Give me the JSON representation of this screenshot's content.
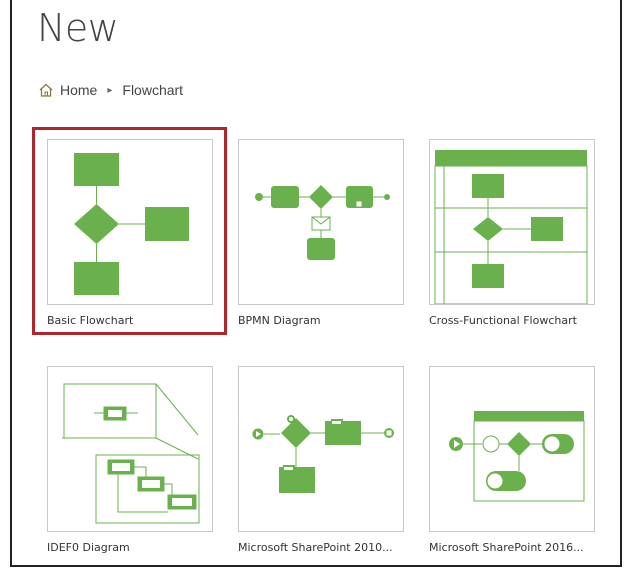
{
  "page": {
    "title": "New"
  },
  "breadcrumb": {
    "home": "Home",
    "current": "Flowchart"
  },
  "templates": [
    {
      "label": "Basic Flowchart",
      "icon": "basic-flowchart-thumbnail",
      "selected": true
    },
    {
      "label": "BPMN Diagram",
      "icon": "bpmn-diagram-thumbnail",
      "selected": false
    },
    {
      "label": "Cross-Functional Flowchart",
      "icon": "cross-functional-flowchart-thumbnail",
      "selected": false
    },
    {
      "label": "IDEF0 Diagram",
      "icon": "idef0-diagram-thumbnail",
      "selected": false
    },
    {
      "label": "Microsoft SharePoint 2010...",
      "icon": "sharepoint-2010-thumbnail",
      "selected": false
    },
    {
      "label": "Microsoft SharePoint 2016...",
      "icon": "sharepoint-2016-thumbnail",
      "selected": false
    }
  ],
  "colors": {
    "shape_green": "#6ab04c",
    "selection_red": "#b0262a"
  }
}
